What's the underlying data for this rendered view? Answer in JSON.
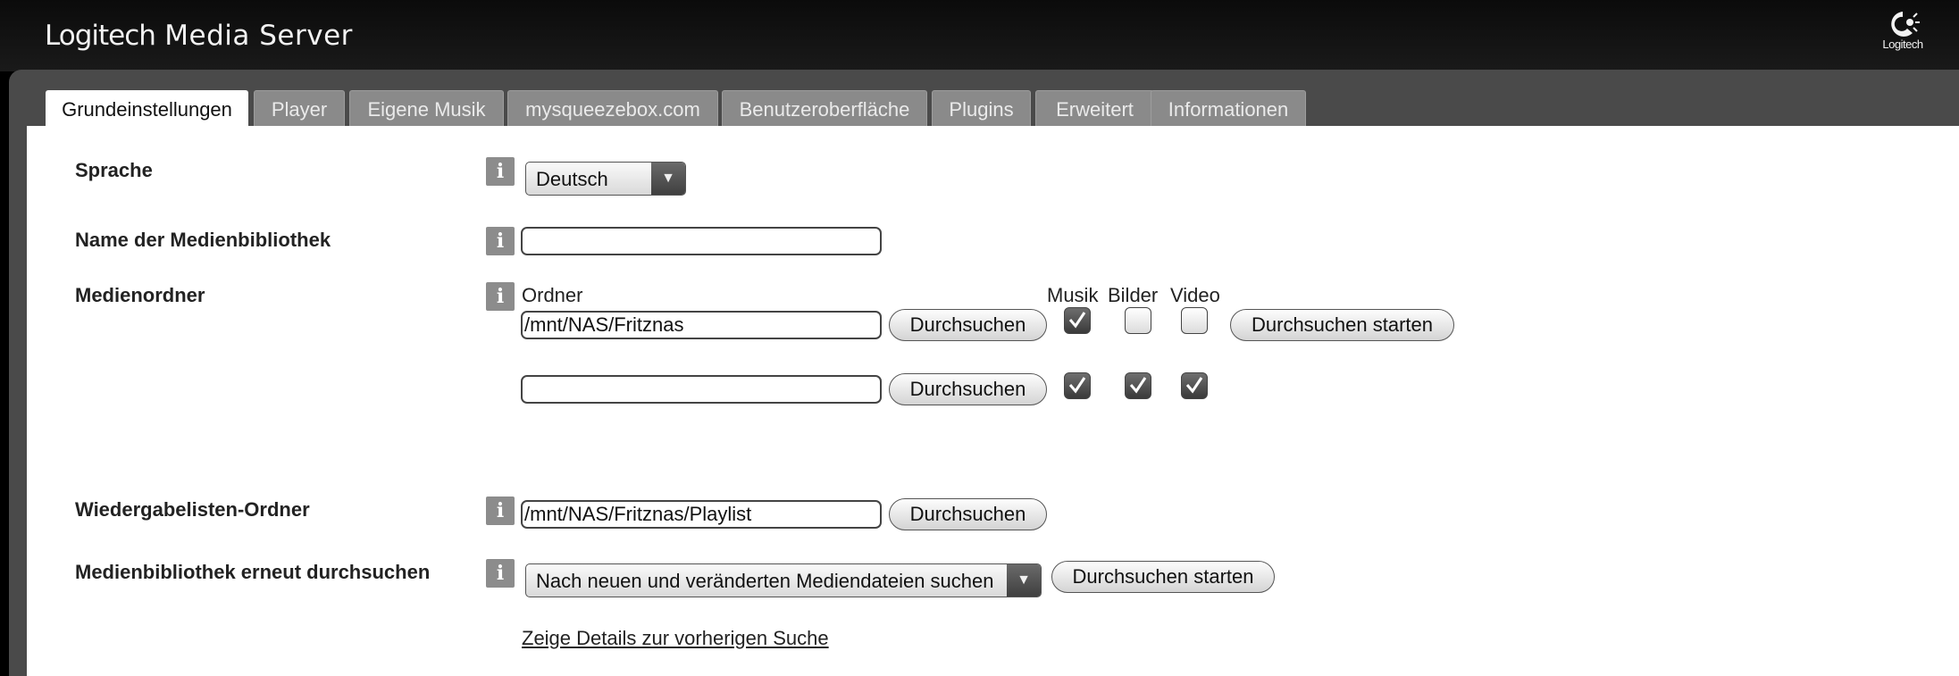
{
  "header": {
    "brand": "Logitech",
    "product": "Media Server",
    "logo_text": "Logitech"
  },
  "tabs": [
    {
      "label": "Grundeinstellungen",
      "active": true
    },
    {
      "label": "Player"
    },
    {
      "label": "Eigene Musik"
    },
    {
      "label": "mysqueezebox.com"
    },
    {
      "label": "Benutzeroberfläche"
    },
    {
      "label": "Plugins"
    },
    {
      "label": "Erweitert"
    },
    {
      "label": "Informationen"
    }
  ],
  "settings": {
    "language": {
      "label": "Sprache",
      "value": "Deutsch"
    },
    "library_name": {
      "label": "Name der Medienbibliothek",
      "value": ""
    },
    "media_folders": {
      "label": "Medienordner",
      "column_folder": "Ordner",
      "column_music": "Musik",
      "column_pictures": "Bilder",
      "column_video": "Video",
      "browse_label": "Durchsuchen",
      "start_scan_label": "Durchsuchen starten",
      "rows": [
        {
          "path": "/mnt/NAS/Fritznas",
          "music": true,
          "pictures": false,
          "video": false
        },
        {
          "path": "",
          "music": true,
          "pictures": true,
          "video": true
        }
      ]
    },
    "playlist_folder": {
      "label": "Wiedergabelisten-Ordner",
      "value": "/mnt/NAS/Fritznas/Playlist",
      "browse_label": "Durchsuchen"
    },
    "rescan": {
      "label": "Medienbibliothek erneut durchsuchen",
      "option": "Nach neuen und veränderten Mediendateien suchen",
      "start_label": "Durchsuchen starten",
      "details_link": "Zeige Details zur vorherigen Suche"
    }
  },
  "info_glyph": "i",
  "dropdown_glyph": "▼"
}
